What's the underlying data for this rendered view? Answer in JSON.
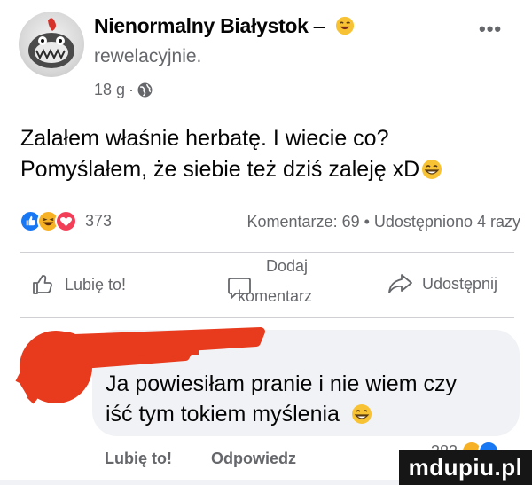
{
  "post": {
    "author": "Nienormalny Białystok",
    "dash": "–",
    "feeling": "rewelacyjnie.",
    "time": "18 g",
    "separator": "·",
    "more_label": "•••",
    "text_line1": "Zalałem właśnie herbatę. I wiecie co?",
    "text_line2": "Pomyślałem, że siebie też dziś zaleję xD"
  },
  "reactions": {
    "count": "373",
    "icons": [
      "like-reaction",
      "haha-reaction",
      "love-reaction"
    ],
    "stats": "Komentarze: 69 • Udostępniono 4 razy"
  },
  "actions": {
    "like": "Lubię to!",
    "comment_line1": "Dodaj",
    "comment_line2": "komentarz",
    "share": "Udostępnij"
  },
  "comment": {
    "line1": "Ja powiesiłam pranie i nie wiem czy",
    "line2": "iść tym tokiem myślenia",
    "like_label": "Lubię to!",
    "reply_label": "Odpowiedz",
    "reaction_count": "383"
  },
  "watermark": "mdupiu.pl",
  "colors": {
    "like_blue": "#1877f2",
    "love_red": "#f33e58",
    "haha_yellow": "#f7b125",
    "secondary_text": "#65676b",
    "bubble_bg": "#f0f2f5"
  }
}
